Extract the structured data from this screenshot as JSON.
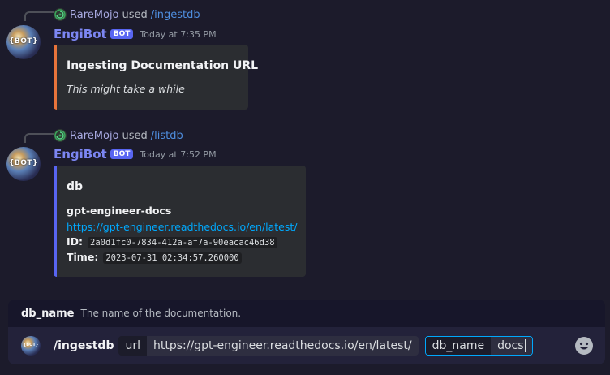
{
  "messages": [
    {
      "reply": {
        "user": "RareMojo",
        "used": "used",
        "command": "/ingestdb"
      },
      "author": "EngiBot",
      "badge": "BOT",
      "timestamp": "Today at 7:35 PM",
      "avatar_text": "{BOT}",
      "embed": {
        "accent": "#e8743b",
        "title": "Ingesting Documentation URL",
        "description": "This might take a while"
      }
    },
    {
      "reply": {
        "user": "RareMojo",
        "used": "used",
        "command": "/listdb"
      },
      "author": "EngiBot",
      "badge": "BOT",
      "timestamp": "Today at 7:52 PM",
      "avatar_text": "{BOT}",
      "embed": {
        "accent": "#5865f2",
        "title": "db",
        "field_name": "gpt-engineer-docs",
        "link": "https://gpt-engineer.readthedocs.io/en/latest/",
        "id_label": "ID:",
        "id_value": "2a0d1fc0-7834-412a-af7a-90eacac46d38",
        "time_label": "Time:",
        "time_value": "2023-07-31 02:34:57.260000"
      }
    }
  ],
  "hint": {
    "option_name": "db_name",
    "option_desc": "The name of the documentation."
  },
  "input": {
    "avatar_text": "{BOT}",
    "command": "/ingestdb",
    "options": [
      {
        "label": "url",
        "value": "https://gpt-engineer.readthedocs.io/en/latest/"
      },
      {
        "label": "db_name",
        "value": "docs"
      }
    ]
  },
  "icons": {
    "reply_avatar": "spiral-avatar-icon",
    "emoji": "emoji-smile-icon"
  },
  "colors": {
    "bot_badge": "#5865f2",
    "link": "#00a8fc",
    "username": "#7c86f2"
  }
}
